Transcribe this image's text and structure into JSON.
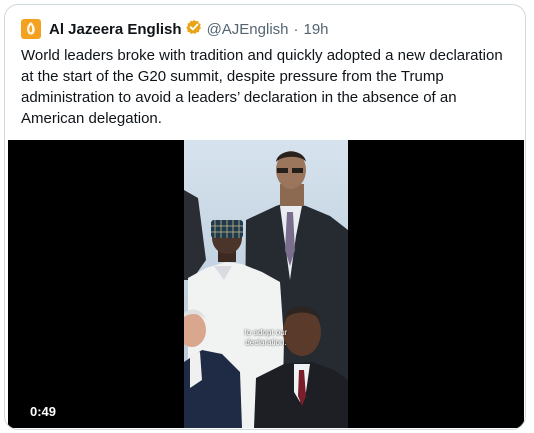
{
  "tweet": {
    "author_name": "Al Jazeera English",
    "handle": "@AJEnglish",
    "separator": "·",
    "time_ago": "19h",
    "text": "World leaders broke with tradition and quickly adopted a new declaration at the start of the G20 summit, despite pressure from the Trump administration to avoid a leaders’ declaration in the absence of an American delegation."
  },
  "video": {
    "caption_overlay": "to adopt our declaration.",
    "duration": "0:49"
  },
  "colors": {
    "brand": "#f4a11f",
    "verified_badge": "#e8a317",
    "text": "#0f1419",
    "secondary_text": "#536471",
    "border": "#cfd9de"
  },
  "icons": [
    "al-jazeera-logo-icon",
    "verified-badge-icon"
  ]
}
